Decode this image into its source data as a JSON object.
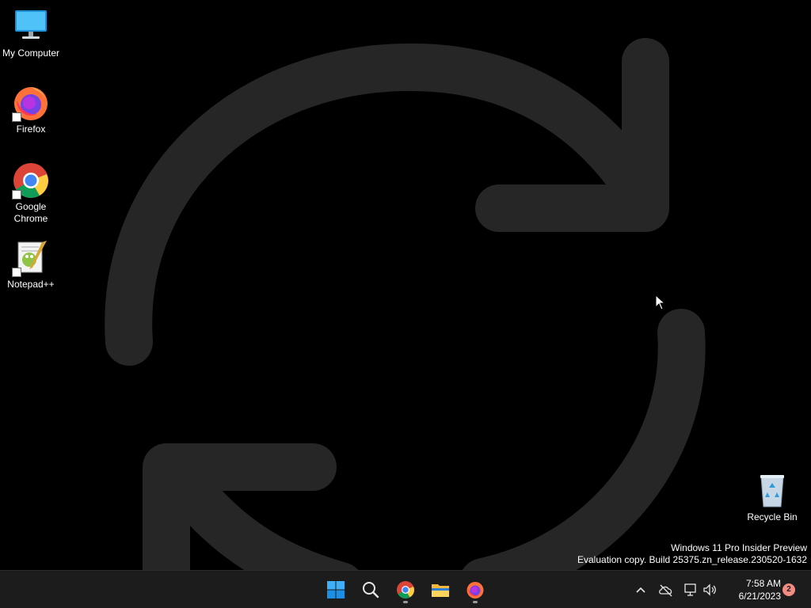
{
  "desktop": {
    "icons": [
      {
        "label": "My Computer",
        "icon": "monitor-icon"
      },
      {
        "label": "Firefox",
        "icon": "firefox-icon"
      },
      {
        "label": "Google Chrome",
        "icon": "chrome-icon"
      },
      {
        "label": "Notepad++",
        "icon": "notepad-plus-plus-icon"
      },
      {
        "label": "Recycle Bin",
        "icon": "recycle-bin-icon"
      }
    ],
    "watermark": {
      "line1": "Windows 11 Pro Insider Preview",
      "line2": "Evaluation copy. Build 25375.zn_release.230520-1632"
    },
    "wallpaper": "refresh-arrows-icon"
  },
  "taskbar": {
    "pinned": [
      {
        "name": "Start",
        "icon": "windows-start-icon"
      },
      {
        "name": "Search",
        "icon": "search-icon"
      },
      {
        "name": "Google Chrome",
        "icon": "chrome-icon",
        "running": true
      },
      {
        "name": "File Explorer",
        "icon": "folder-icon"
      },
      {
        "name": "Firefox",
        "icon": "firefox-icon",
        "running": true
      }
    ],
    "tray": {
      "icons": [
        "chevron-up-icon",
        "onedrive-offline-icon",
        "network-icon",
        "volume-icon"
      ],
      "time": "7:58 AM",
      "date": "6/21/2023",
      "notification_count": "2"
    }
  },
  "colors": {
    "taskbar_bg": "#1c1c1c",
    "wallpaper_stroke": "#262626",
    "accent_blue": "#0078d4",
    "badge": "#f28b82"
  }
}
